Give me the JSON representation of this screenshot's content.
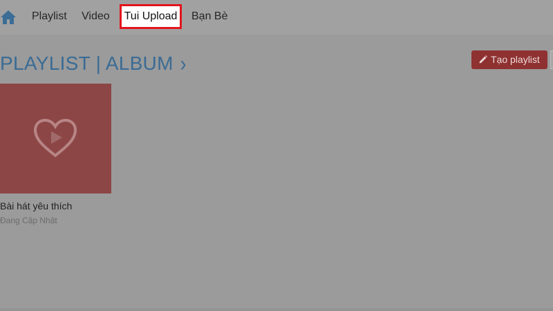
{
  "nav": {
    "home_icon": "home-icon",
    "items": [
      {
        "label": "Playlist"
      },
      {
        "label": "Video"
      },
      {
        "label": "Tui Upload",
        "highlighted": true
      },
      {
        "label": "Bạn Bè"
      }
    ]
  },
  "section": {
    "title": "PLAYLIST | ALBUM",
    "chevron": "›"
  },
  "actions": {
    "create_label": "Tạo playlist",
    "create_icon": "pencil-icon"
  },
  "albums": [
    {
      "title": "Bài hát yêu thích",
      "meta": "Đang Cập Nhật",
      "icon": "heart-play-icon"
    }
  ],
  "colors": {
    "highlight_border": "#e3141c",
    "title_blue": "#3a6b94",
    "button_red": "#8e3130",
    "thumb_red": "#8d4646"
  }
}
